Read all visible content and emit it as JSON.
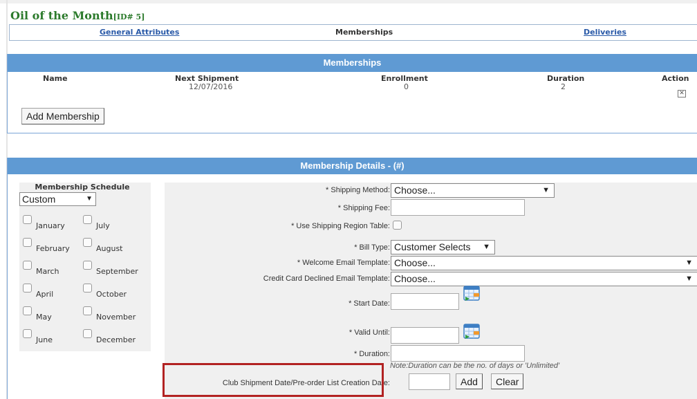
{
  "page": {
    "title": "Oil of the Month",
    "id_tag": "[ID# 5]"
  },
  "tabs": [
    {
      "label": "General Attributes"
    },
    {
      "label": "Memberships"
    },
    {
      "label": "Deliveries"
    }
  ],
  "memberships": {
    "header": "Memberships",
    "columns": [
      "Name",
      "Next Shipment",
      "Enrollment",
      "Duration",
      "Action"
    ],
    "rows": [
      {
        "name": "",
        "next_shipment": "12/07/2016",
        "enrollment": "0",
        "duration": "2",
        "action_icon": "close-box-icon"
      }
    ],
    "add_button": "Add Membership"
  },
  "details": {
    "header": "Membership Details - (#)",
    "schedule": {
      "title": "Membership Schedule",
      "selected": "Custom",
      "months": [
        "January",
        "July",
        "February",
        "August",
        "March",
        "September",
        "April",
        "October",
        "May",
        "November",
        "June",
        "December"
      ]
    },
    "form": {
      "shipping_method": {
        "label": "* Shipping Method:",
        "value": "Choose..."
      },
      "shipping_fee": {
        "label": "* Shipping Fee:",
        "value": ""
      },
      "use_region_table": {
        "label": "* Use Shipping Region Table:"
      },
      "bill_type": {
        "label": "* Bill Type:",
        "value": "Customer Selects"
      },
      "welcome_template": {
        "label": "* Welcome Email Template:",
        "value": "Choose..."
      },
      "declined_template": {
        "label": "Credit Card Declined Email Template:",
        "value": "Choose..."
      },
      "start_date": {
        "label": "* Start Date:",
        "value": ""
      },
      "valid_until": {
        "label": "* Valid Until:",
        "value": ""
      },
      "duration": {
        "label": "* Duration:",
        "value": ""
      },
      "duration_note": "Note:Duration can be the no. of days or 'Unlimited'",
      "club_shipment": {
        "label": "Club Shipment Date/Pre-order List Creation Date:",
        "value": ""
      },
      "add_button": "Add",
      "clear_button": "Clear"
    }
  },
  "colors": {
    "section_header": "#5f9ad3",
    "title_green": "#2b7a2b",
    "link_blue": "#2a5aa8",
    "highlight_red": "#b22222"
  }
}
